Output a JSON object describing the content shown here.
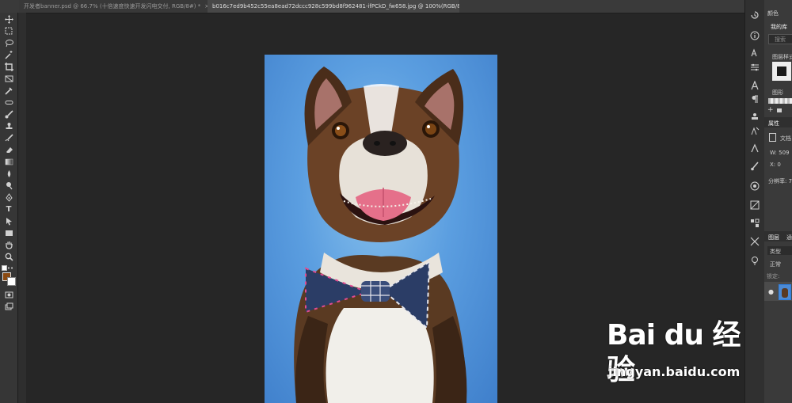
{
  "tabs": [
    {
      "label": "开发者banner.psd @ 66.7% (十倍速度快速开发闪电交付, RGB/8#) *",
      "active": false
    },
    {
      "label": "b016c7ed9b452c55ea8ead72dccc928c599bd8f962481-ifPCkD_fw658.jpg @ 100%(RGB/8*) *",
      "active": true
    }
  ],
  "close_glyph": "×",
  "toolbar": {
    "tools": [
      "move-tool-icon",
      "marquee-tool-icon",
      "lasso-tool-icon",
      "magic-wand-tool-icon",
      "crop-tool-icon",
      "frame-tool-icon",
      "eyedropper-tool-icon",
      "healing-brush-tool-icon",
      "brush-tool-icon",
      "clone-stamp-tool-icon",
      "history-brush-tool-icon",
      "eraser-tool-icon",
      "gradient-tool-icon",
      "blur-tool-icon",
      "dodge-tool-icon",
      "pen-tool-icon",
      "type-tool-icon",
      "path-select-tool-icon",
      "rectangle-tool-icon",
      "hand-tool-icon",
      "zoom-tool-icon",
      "more-tools-icon"
    ],
    "type_tool_glyph": "T",
    "more_glyph": "•••",
    "foreground_color": "#8a4a12",
    "background_color": "#ffffff"
  },
  "panels": {
    "color_tab": "颜色",
    "library_tab": "我的库",
    "search_placeholder": "搜索",
    "layer_style_label": "图层样式",
    "graphics_label": "图形",
    "properties_tab": "属性",
    "document_label": "文档",
    "width_label": "W:",
    "width_value": "509",
    "x_label": "X:",
    "x_value": "0",
    "resolution_label": "分辨率: 7",
    "layers_tab": "图层",
    "layers_tab2": "通",
    "kind_filter": "类型",
    "blend_mode": "正常",
    "lock_label": "锁定:",
    "accent_color": "#2d7ee0"
  },
  "watermark": {
    "logo_text": "Bai du 经验",
    "url": "jingyan.baidu.com"
  }
}
